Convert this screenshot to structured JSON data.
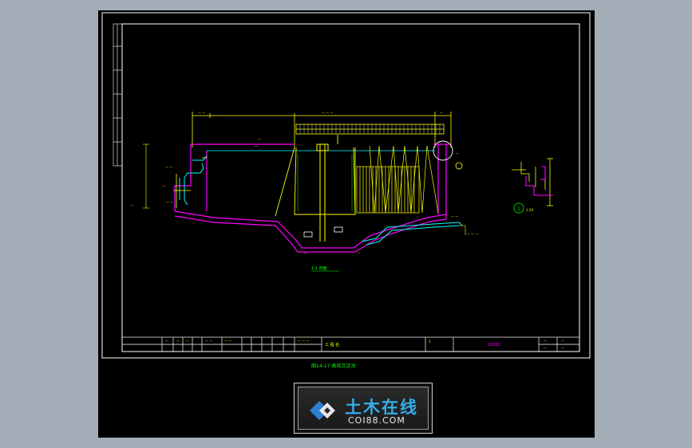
{
  "sheet": {
    "caption": "图14-17  高效沉淀池",
    "section_label": "1-1 剖面",
    "detail_number": "1",
    "detail_scale": "1:20",
    "drawing_number": "S0201",
    "title_cell": "工 程 名"
  },
  "watermark": {
    "name": "土木在线",
    "domain": "COI88.COM"
  },
  "colors": {
    "background": "#000000",
    "frame": "#ffffff",
    "wall": "#ff00ff",
    "structure": "#ffff00",
    "pipe": "#00ffff",
    "dimension": "#00ff00",
    "logo_blue": "#33aee8"
  }
}
